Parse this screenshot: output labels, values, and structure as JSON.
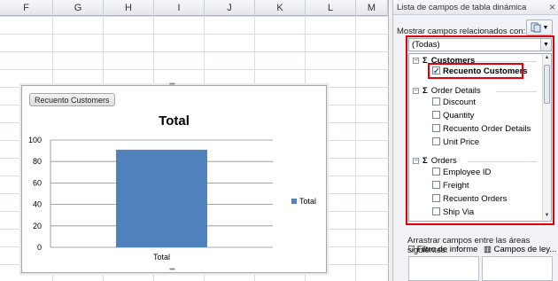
{
  "sheet": {
    "columns": [
      "F",
      "G",
      "H",
      "I",
      "J",
      "K",
      "L",
      "M"
    ]
  },
  "chart": {
    "field_button": "Recuento Customers",
    "title": "Total",
    "legend_label": "Total",
    "bar_color": "#4f81bd"
  },
  "chart_data": {
    "type": "bar",
    "title": "Total",
    "categories": [
      "Total"
    ],
    "series": [
      {
        "name": "Total",
        "values": [
          91
        ]
      }
    ],
    "y_ticks": [
      0,
      20,
      40,
      60,
      80,
      100
    ],
    "ylim": [
      0,
      100
    ],
    "grid": true,
    "legend": "right"
  },
  "pane": {
    "title": "Lista de campos de tabla dinámica",
    "close_glyph": "×",
    "mostrar_label": "Mostrar campos relacionados con:",
    "select_value": "(Todas)",
    "groups": [
      {
        "label": "Customers",
        "fields": [
          {
            "label": "Recuento Customers",
            "checked": true
          }
        ]
      },
      {
        "label": "Order Details",
        "fields": [
          {
            "label": "Discount",
            "checked": false
          },
          {
            "label": "Quantity",
            "checked": false
          },
          {
            "label": "Recuento Order Details",
            "checked": false
          },
          {
            "label": "Unit Price",
            "checked": false
          }
        ]
      },
      {
        "label": "Orders",
        "fields": [
          {
            "label": "Employee ID",
            "checked": false
          },
          {
            "label": "Freight",
            "checked": false
          },
          {
            "label": "Recuento Orders",
            "checked": false
          },
          {
            "label": "Ship Via",
            "checked": false
          }
        ]
      }
    ],
    "drag_label": "Arrastrar campos entre las áreas siguientes:",
    "area_filter": "Filtro de informe",
    "area_legend": "Campos de ley..."
  },
  "colors": {
    "highlight_border": "#e0000a",
    "bar": "#4f81bd"
  }
}
